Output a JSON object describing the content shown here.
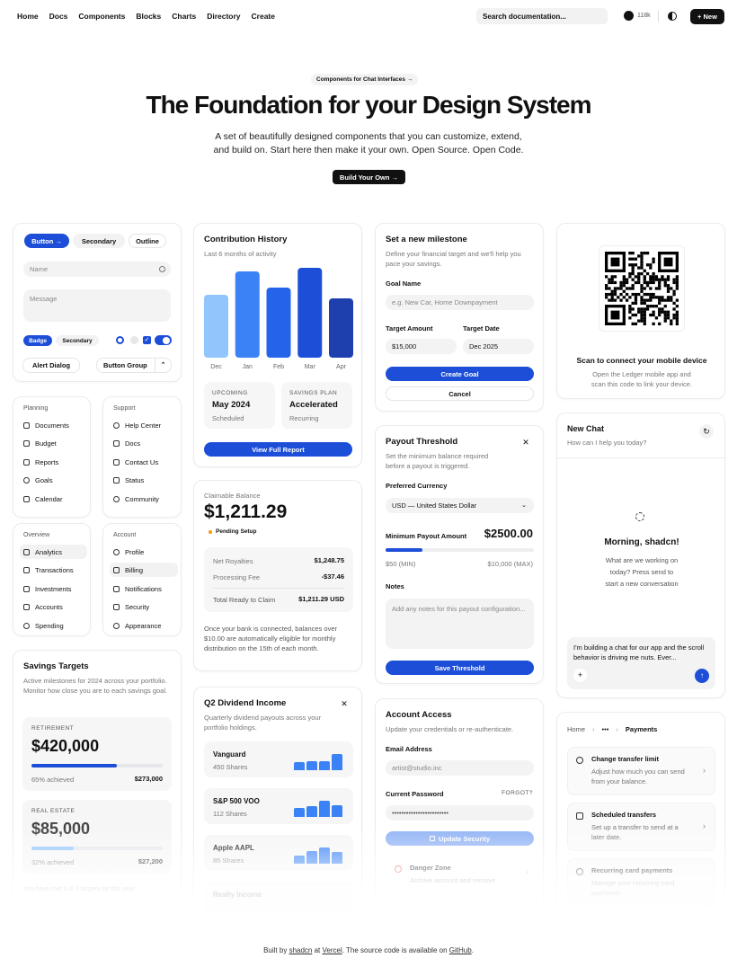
{
  "nav": {
    "links": [
      "Home",
      "Docs",
      "Components",
      "Blocks",
      "Charts",
      "Directory",
      "Create"
    ],
    "search_placeholder": "Search documentation...",
    "github_stars": "118k",
    "new_label": "New"
  },
  "hero": {
    "pill": "Components for Chat Interfaces →",
    "title": "The Foundation for your Design System",
    "subtitle_1": "A set of beautifully designed components that you can customize, extend,",
    "subtitle_2": "and build on. Start here then make it your own. Open Source. Open Code.",
    "cta": "Build Your Own →"
  },
  "buttons_card": {
    "button": "Button →",
    "secondary": "Secondary",
    "outline": "Outline",
    "name_placeholder": "Name",
    "message_placeholder": "Message",
    "badge": "Badge",
    "badge_secondary": "Secondary",
    "alert_dialog": "Alert Dialog",
    "button_group": "Button Group"
  },
  "menu_planning": {
    "header": "Planning",
    "items": [
      "Documents",
      "Budget",
      "Reports",
      "Goals",
      "Calendar"
    ]
  },
  "menu_support": {
    "header": "Support",
    "items": [
      "Help Center",
      "Docs",
      "Contact Us",
      "Status",
      "Community"
    ]
  },
  "menu_overview": {
    "header": "Overview",
    "items": [
      "Analytics",
      "Transactions",
      "Investments",
      "Accounts",
      "Spending"
    ]
  },
  "menu_account": {
    "header": "Account",
    "items": [
      "Profile",
      "Billing",
      "Notifications",
      "Security",
      "Appearance"
    ]
  },
  "savings": {
    "title": "Savings Targets",
    "desc": "Active milestones for 2024 across your portfolio. Monitor how close you are to each savings goal.",
    "t1_label": "RETIREMENT",
    "t1_amount": "$420,000",
    "t1_pct": "65% achieved",
    "t1_value": "$273,000",
    "t1_progress": 0.65,
    "t2_label": "REAL ESTATE",
    "t2_amount": "$85,000",
    "t2_pct": "32% achieved",
    "t2_value": "$27,200",
    "t2_progress": 0.32,
    "footer": "You have met 1 of 3 targets for this year"
  },
  "contribution": {
    "title": "Contribution History",
    "subtitle": "Last 6 months of activity",
    "upcoming_label": "UPCOMING",
    "upcoming_value": "May 2024",
    "upcoming_sub": "Scheduled",
    "plan_label": "SAVINGS PLAN",
    "plan_value": "Accelerated",
    "plan_sub": "Recurring",
    "report_button": "View Full Report"
  },
  "chart_data": {
    "type": "bar",
    "categories": [
      "Dec",
      "Jan",
      "Feb",
      "Mar",
      "Apr"
    ],
    "values": [
      0.7,
      0.96,
      0.78,
      1.0,
      0.66
    ],
    "colors": [
      "#93c5fd",
      "#3b82f6",
      "#2563eb",
      "#1d4ed8",
      "#1e40af"
    ],
    "title": "Contribution History",
    "xlabel": "",
    "ylabel": ""
  },
  "balance": {
    "label": "Claimable Balance",
    "amount": "$1,211.29",
    "status": "Pending Setup",
    "r1_label": "Net Royalties",
    "r1_value": "$1,248.75",
    "r2_label": "Processing Fee",
    "r2_value": "-$37.46",
    "r3_label": "Total Ready to Claim",
    "r3_value": "$1,211.29 USD",
    "note": "Once your bank is connected, balances over $10.00 are automatically eligible for monthly distribution on the 15th of each month."
  },
  "dividend": {
    "title": "Q2 Dividend Income",
    "desc": "Quarterly dividend payouts across your portfolio holdings.",
    "rows": [
      {
        "name": "Vanguard",
        "shares": "450 Shares"
      },
      {
        "name": "S&P 500 VOO",
        "shares": "112 Shares"
      },
      {
        "name": "Apple AAPL",
        "shares": "85 Shares"
      },
      {
        "name": "Realty Income",
        "shares": ""
      }
    ]
  },
  "milestone": {
    "title": "Set a new milestone",
    "desc": "Define your financial target and we'll help you pace your savings.",
    "goal_label": "Goal Name",
    "goal_placeholder": "e.g. New Car, Home Downpayment",
    "amount_label": "Target Amount",
    "amount_value": "$15,000",
    "date_label": "Target Date",
    "date_value": "Dec 2025",
    "create": "Create Goal",
    "cancel": "Cancel"
  },
  "payout": {
    "title": "Payout Threshold",
    "desc": "Set the minimum balance required before a payout is triggered.",
    "currency_label": "Preferred Currency",
    "currency_value": "USD — United States Dollar",
    "min_label": "Minimum Payout Amount",
    "min_value": "$2500.00",
    "range_min": "$50 (MIN)",
    "range_max": "$10,000 (MAX)",
    "slider_fraction": 0.25,
    "notes_label": "Notes",
    "notes_placeholder": "Add any notes for this payout configuration...",
    "save": "Save Threshold"
  },
  "access": {
    "title": "Account Access",
    "desc": "Update your credentials or re-authenticate.",
    "email_label": "Email Address",
    "email_value": "artist@studio.inc",
    "password_label": "Current Password",
    "forgot": "FORGOT?",
    "password_value": "••••••••••••••••••••••••",
    "update": "Update Security",
    "danger_title": "Danger Zone",
    "danger_desc": "Archive account and remove"
  },
  "qr": {
    "title": "Scan to connect your mobile device",
    "desc_1": "Open the Ledger mobile app and",
    "desc_2": "scan this code to link your device."
  },
  "chat": {
    "title": "New Chat",
    "subtitle": "How can I help you today?",
    "greeting": "Morning, shadcn!",
    "prompt_1": "What are we working on",
    "prompt_2": "today? Press send to",
    "prompt_3": "start a new conversation",
    "draft": "I'm building a chat for our app and the scroll behavior is driving me nuts. Ever..."
  },
  "payments": {
    "crumb_home": "Home",
    "crumb_more": "•••",
    "crumb_current": "Payments",
    "items": [
      {
        "title": "Change transfer limit",
        "desc": "Adjust how much you can send from your balance."
      },
      {
        "title": "Scheduled transfers",
        "desc": "Set up a transfer to send at a later date."
      },
      {
        "title": "Recurring card payments",
        "desc": "Manage your recurring card payments"
      }
    ]
  },
  "footer": {
    "pre": "Built by ",
    "author": "shadcn",
    "mid": " at ",
    "company": "Vercel",
    "post": ". The source code is available on ",
    "repo": "GitHub",
    "end": "."
  },
  "colors": {
    "primary": "#1d4ed8",
    "dark": "#111111"
  }
}
